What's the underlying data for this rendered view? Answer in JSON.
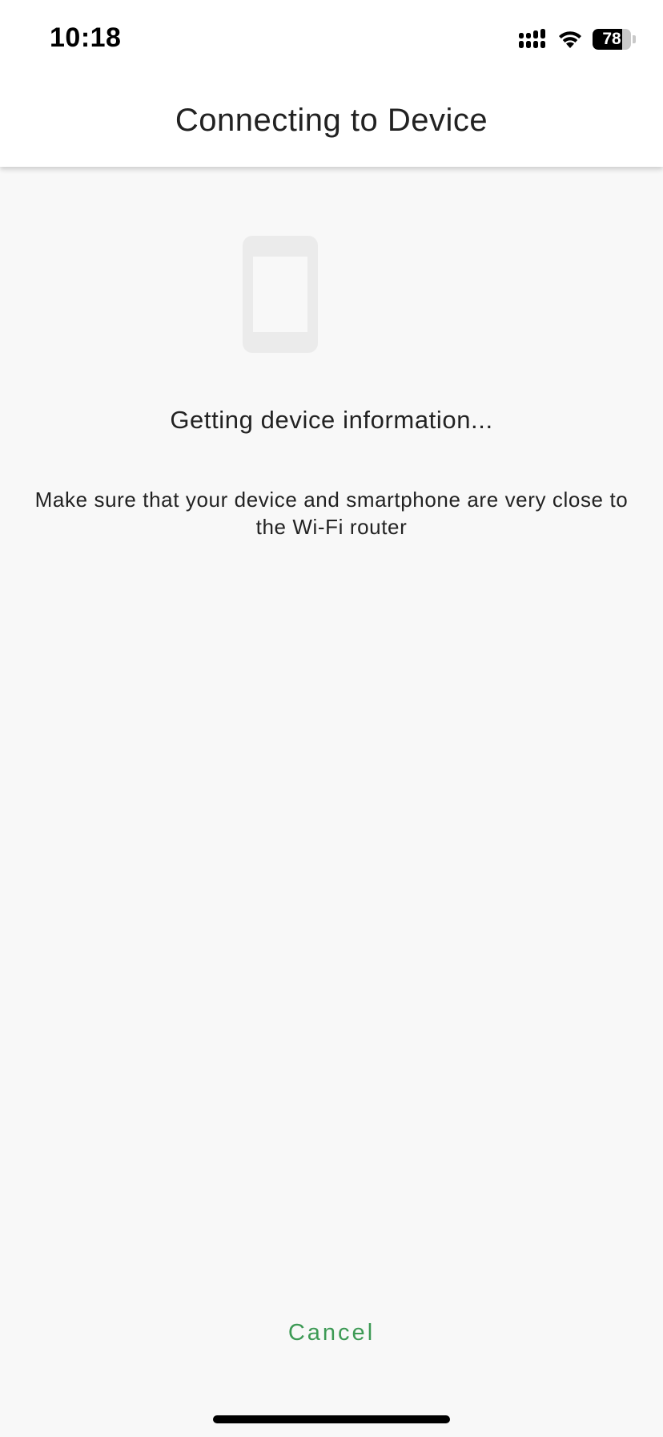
{
  "status_bar": {
    "time": "10:18",
    "signal_icon": "cellular-signal-icon",
    "wifi_icon": "wifi-icon",
    "battery_level": "78",
    "battery_fraction": 0.78
  },
  "nav": {
    "title": "Connecting to Device"
  },
  "illustration": {
    "icon": "smartphone-icon",
    "color": "#ebebeb"
  },
  "main": {
    "status_heading": "Getting device information...",
    "hint": "Make sure that your device and smartphone are very close to the Wi-Fi router"
  },
  "actions": {
    "cancel_label": "Cancel",
    "cancel_color": "#3d9a55"
  }
}
